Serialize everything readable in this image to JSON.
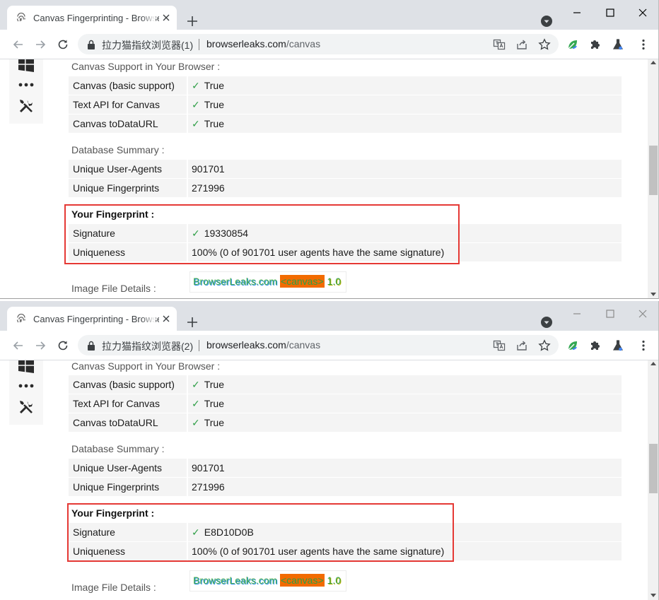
{
  "windows": [
    {
      "tab_title": "Canvas Fingerprinting - BrowserLeaks",
      "site_name": "拉力猫指纹浏览器(1)",
      "url_host": "browserleaks.com",
      "url_path": "/canvas",
      "support_label": "Canvas Support in Your Browser :",
      "support_rows": [
        {
          "key": "Canvas (basic support)",
          "value": "True"
        },
        {
          "key": "Text API for Canvas",
          "value": "True"
        },
        {
          "key": "Canvas toDataURL",
          "value": "True"
        }
      ],
      "db_label": "Database Summary :",
      "db_rows": [
        {
          "key": "Unique User-Agents",
          "value": "901701"
        },
        {
          "key": "Unique Fingerprints",
          "value": "271996"
        }
      ],
      "fp_title": "Your Fingerprint :",
      "fp_rows": [
        {
          "key": "Signature",
          "value": "19330854"
        },
        {
          "key": "Uniqueness",
          "value": "100% (0 of 901701 user agents have the same signature)"
        }
      ],
      "img_label": "Image File Details :",
      "img_text_a": "BrowserLeaks.com ",
      "img_text_tag": "<canvas>",
      "img_text_v": " 1.0"
    },
    {
      "tab_title": "Canvas Fingerprinting - BrowserLeaks",
      "site_name": "拉力猫指纹浏览器(2)",
      "url_host": "browserleaks.com",
      "url_path": "/canvas",
      "support_label": "Canvas Support in Your Browser :",
      "support_rows": [
        {
          "key": "Canvas (basic support)",
          "value": "True"
        },
        {
          "key": "Text API for Canvas",
          "value": "True"
        },
        {
          "key": "Canvas toDataURL",
          "value": "True"
        }
      ],
      "db_label": "Database Summary :",
      "db_rows": [
        {
          "key": "Unique User-Agents",
          "value": "901701"
        },
        {
          "key": "Unique Fingerprints",
          "value": "271996"
        }
      ],
      "fp_title": "Your Fingerprint :",
      "fp_rows": [
        {
          "key": "Signature",
          "value": "E8D10D0B"
        },
        {
          "key": "Uniqueness",
          "value": "100% (0 of 901701 user agents have the same signature)"
        }
      ],
      "img_label": "Image File Details :",
      "img_text_a": "BrowserLeaks.com ",
      "img_text_tag": "<canvas>",
      "img_text_v": " 1.0"
    }
  ],
  "icons": {
    "favicon": "fingerprint-icon",
    "tab_close": "close-icon",
    "new_tab": "plus-icon",
    "tab_search": "chevron-down-circle-icon",
    "back": "arrow-left-icon",
    "forward": "arrow-right-icon",
    "reload": "reload-icon",
    "lock": "lock-icon",
    "translate": "translate-icon",
    "share": "share-icon",
    "bookmark": "star-icon",
    "extension_leaf": "leaf-extension-icon",
    "extensions": "puzzle-icon",
    "labs": "flask-icon",
    "menu": "kebab-menu-icon",
    "windows": "windows-logo-icon",
    "more": "more-dots-icon",
    "tools": "tools-icon"
  },
  "colors": {
    "tabstrip_bg": "#dee1e6",
    "check_green": "#2e9e46",
    "highlight_red": "#e53935",
    "canvas_tag_orange": "#f26b00",
    "row_bg": "#f4f4f4"
  }
}
